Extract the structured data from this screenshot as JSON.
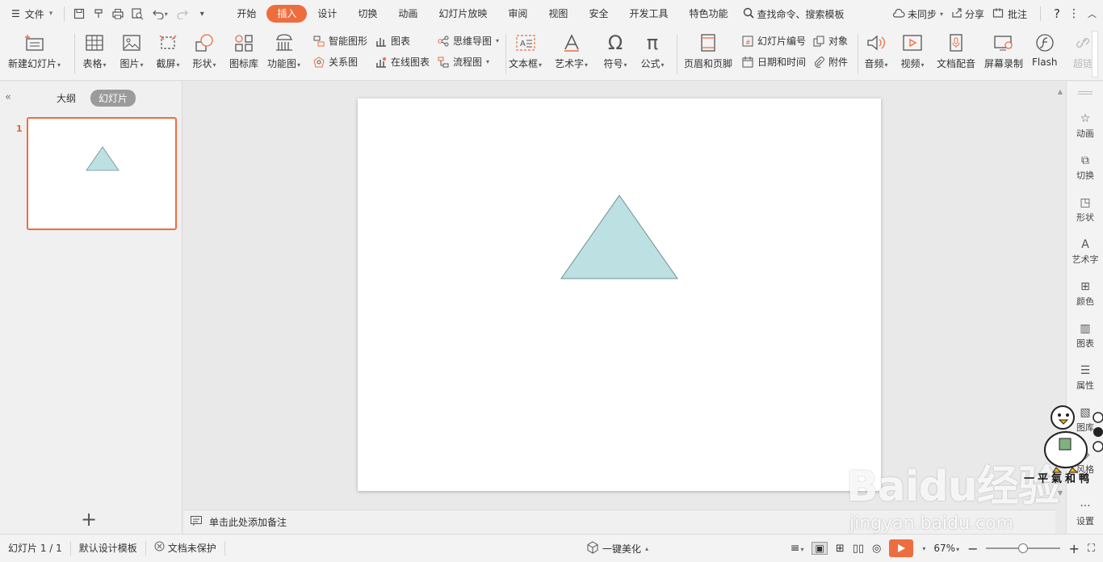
{
  "menubar": {
    "file_label": "文件",
    "tabs": [
      "开始",
      "插入",
      "设计",
      "切换",
      "动画",
      "幻灯片放映",
      "审阅",
      "视图",
      "安全",
      "开发工具",
      "特色功能"
    ],
    "active_tab": "插入",
    "search_label": "查找命令、搜索模板",
    "sync_label": "未同步",
    "share_label": "分享",
    "comment_label": "批注"
  },
  "ribbon": {
    "new_slide": "新建幻灯片",
    "table": "表格",
    "picture": "图片",
    "screenshot": "截屏",
    "shape": "形状",
    "icon_lib": "图标库",
    "func_chart": "功能图",
    "smart_art": "智能图形",
    "relation": "关系图",
    "chart": "图表",
    "online_chart": "在线图表",
    "mindmap": "思维导图",
    "flowchart": "流程图",
    "textbox": "文本框",
    "wordart": "艺术字",
    "symbol": "符号",
    "formula": "公式",
    "header_footer": "页眉和页脚",
    "slide_number": "幻灯片编号",
    "datetime": "日期和时间",
    "object": "对象",
    "attachment": "附件",
    "audio": "音频",
    "video": "视频",
    "doc_voice": "文档配音",
    "screen_record": "屏幕录制",
    "flash": "Flash",
    "hyperlink": "超链"
  },
  "leftpanel": {
    "outline_tab": "大纲",
    "slides_tab": "幻灯片",
    "slide_number": "1"
  },
  "notes": {
    "placeholder": "单击此处添加备注"
  },
  "rightbar": [
    "动画",
    "切换",
    "形状",
    "艺术字",
    "颜色",
    "图表",
    "属性",
    "图库",
    "风格",
    "设置"
  ],
  "statusbar": {
    "slide_pos": "幻灯片 1 / 1",
    "template": "默认设计模板",
    "protect": "文档未保护",
    "beautify": "一键美化",
    "zoom": "67%",
    "zoom_fraction": 0.5
  },
  "slide": {
    "shape": "triangle",
    "fill": "#bde0e3",
    "stroke": "#6f8f93"
  },
  "watermark": {
    "brand": "Baidu经验",
    "url": "jingyan.baidu.com",
    "duck_text": "一平氣和鸭"
  },
  "colors": {
    "accent": "#ee6d3e"
  }
}
